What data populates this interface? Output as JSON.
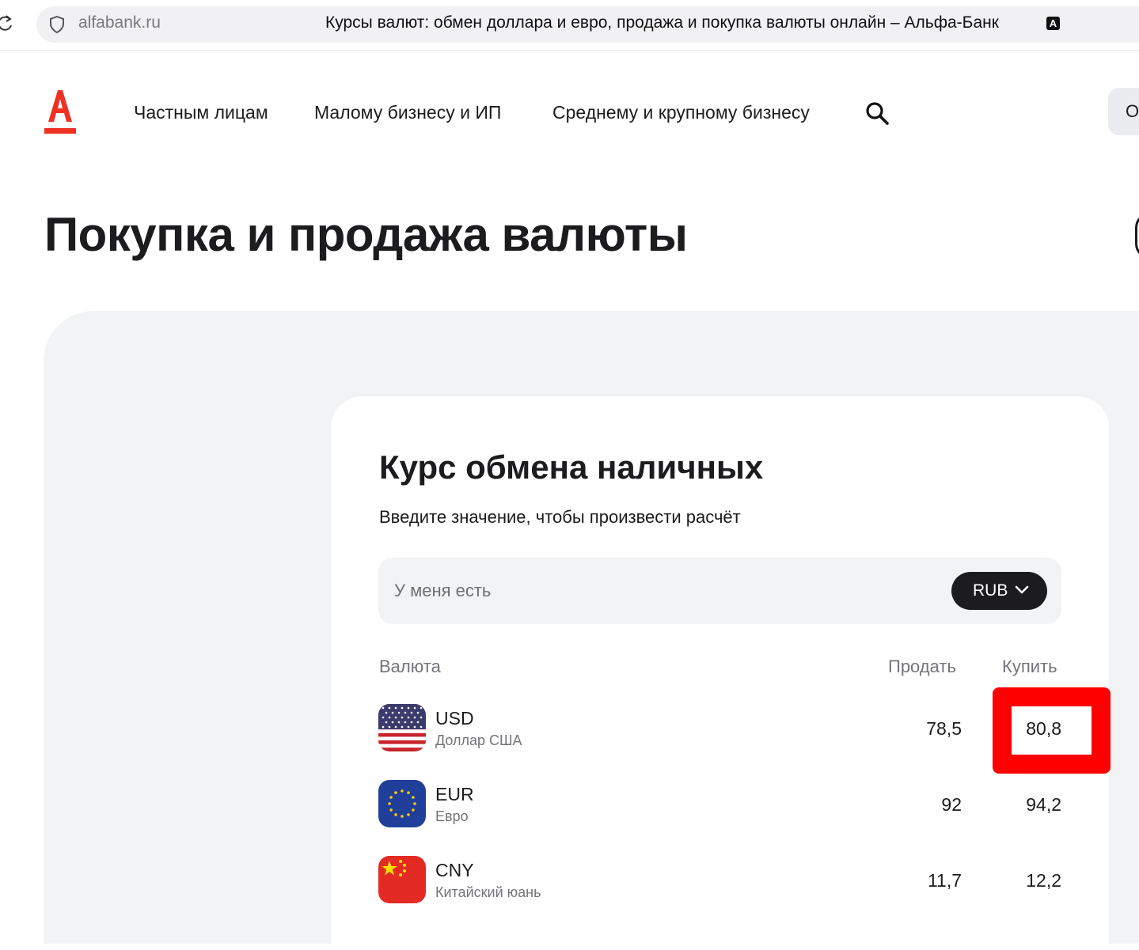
{
  "browser": {
    "url": "alfabank.ru",
    "tab_title": "Курсы валют: обмен доллара и евро, продажа и покупка валюты онлайн – Альфа-Банк",
    "translate_glyph": "A"
  },
  "header": {
    "nav": [
      "Частным лицам",
      "Малому бизнесу и ИП",
      "Среднему и крупному бизнесу"
    ],
    "right_button_label": "О"
  },
  "hero": {
    "title": "Покупка и продажа валюты"
  },
  "exchange": {
    "title": "Курс обмена наличных",
    "subtitle": "Введите значение, чтобы произвести расчёт",
    "input_placeholder": "У меня есть",
    "selected_currency": "RUB",
    "columns": {
      "currency": "Валюта",
      "sell": "Продать",
      "buy": "Купить"
    },
    "rows": [
      {
        "code": "USD",
        "name": "Доллар США",
        "sell": "78,5",
        "buy": "80,8",
        "flag": "us-flag-icon"
      },
      {
        "code": "EUR",
        "name": "Евро",
        "sell": "92",
        "buy": "94,2",
        "flag": "eu-flag-icon"
      },
      {
        "code": "CNY",
        "name": "Китайский юань",
        "sell": "11,7",
        "buy": "12,2",
        "flag": "cn-flag-icon"
      }
    ]
  },
  "colors": {
    "brand_red": "#ef3124",
    "highlight": "#ff0000",
    "panel_bg": "#f2f3f5",
    "text": "#1c1c1e"
  }
}
